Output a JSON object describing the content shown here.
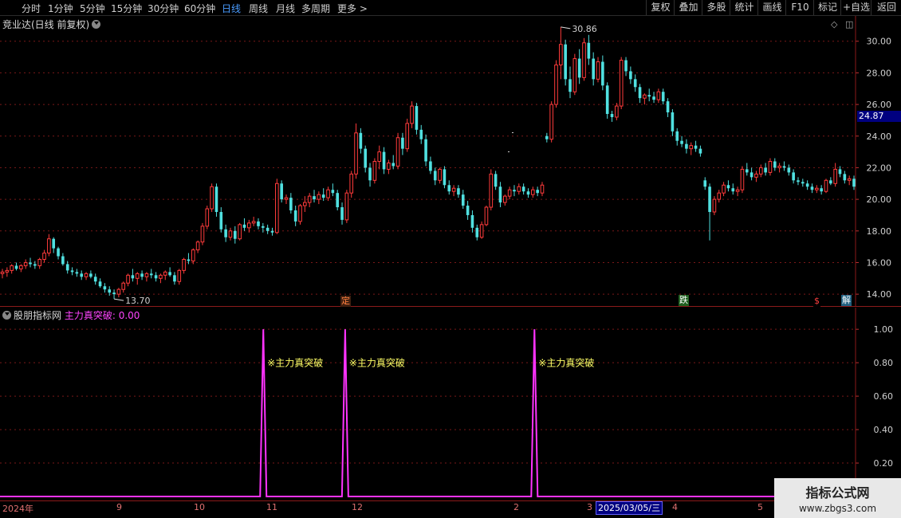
{
  "toolbar": {
    "tabs": [
      "分时",
      "1分钟",
      "5分钟",
      "15分钟",
      "30分钟",
      "60分钟",
      "日线",
      "周线",
      "月线",
      "多周期",
      "更多 >"
    ],
    "active_tab": "日线",
    "right_buttons": [
      "复权",
      "叠加",
      "多股",
      "统计",
      "画线",
      "F10",
      "标记",
      "+自选",
      "返回"
    ]
  },
  "main_chart": {
    "title": "竞业达(日线 前复权)",
    "high_marker": "30.86",
    "low_marker": "13.70",
    "current_price": "24.87",
    "event_tags": [
      {
        "label": "定",
        "color": "#ff8040",
        "bg": "#402010"
      },
      {
        "label": "跌",
        "color": "#ffffff",
        "bg": "#206020"
      },
      {
        "label": "$",
        "color": "#ff4040",
        "bg": "#000000"
      },
      {
        "label": "解",
        "color": "#ffffff",
        "bg": "#206080"
      }
    ],
    "colors": {
      "up": "#ff3b3b",
      "down": "#50e0e0",
      "grid": "#7a1818",
      "axis": "#8b1a1a"
    }
  },
  "indicator": {
    "source": "股朋指标网",
    "name": "主力真突破",
    "value": "0.00",
    "signal_label": "※主力真突破",
    "color": "#ff33ff",
    "label_color": "#ffff66"
  },
  "date_axis": {
    "labels": [
      "2024年",
      "9",
      "10",
      "11",
      "12",
      "2",
      "3",
      "4",
      "5"
    ],
    "cursor_date": "2025/03/05/三"
  },
  "watermark": {
    "title": "指标公式网",
    "url": "www.zbgs3.com"
  },
  "chart_data": [
    {
      "type": "candlestick",
      "title": "竞业达(日线 前复权)",
      "ylim": [
        13.2,
        31.6
      ],
      "y_ticks": [
        14,
        16,
        18,
        20,
        22,
        24,
        26,
        28,
        30
      ],
      "x_labels": [
        "2024年",
        "9",
        "10",
        "11",
        "12",
        "2",
        "3",
        "4",
        "5"
      ],
      "ohlc": [
        [
          15.3,
          15.6,
          15.0,
          15.4
        ],
        [
          15.4,
          15.7,
          15.1,
          15.5
        ],
        [
          15.5,
          15.9,
          15.3,
          15.8
        ],
        [
          15.8,
          16.0,
          15.5,
          15.6
        ],
        [
          15.6,
          15.9,
          15.4,
          15.8
        ],
        [
          15.8,
          16.2,
          15.6,
          16.0
        ],
        [
          16.0,
          16.3,
          15.7,
          15.9
        ],
        [
          15.9,
          16.1,
          15.6,
          15.8
        ],
        [
          15.8,
          16.3,
          15.6,
          16.2
        ],
        [
          16.2,
          16.8,
          16.0,
          16.6
        ],
        [
          16.6,
          17.8,
          16.4,
          17.5
        ],
        [
          17.5,
          17.6,
          16.6,
          16.9
        ],
        [
          16.9,
          17.0,
          16.2,
          16.4
        ],
        [
          16.4,
          16.6,
          15.8,
          15.9
        ],
        [
          15.9,
          16.1,
          15.3,
          15.5
        ],
        [
          15.5,
          15.7,
          15.2,
          15.4
        ],
        [
          15.4,
          15.6,
          15.1,
          15.3
        ],
        [
          15.3,
          15.5,
          14.9,
          15.1
        ],
        [
          15.1,
          15.4,
          14.9,
          15.3
        ],
        [
          15.3,
          15.5,
          15.0,
          15.1
        ],
        [
          15.1,
          15.3,
          14.6,
          14.8
        ],
        [
          14.8,
          15.0,
          14.4,
          14.5
        ],
        [
          14.5,
          14.7,
          14.1,
          14.3
        ],
        [
          14.3,
          14.5,
          13.9,
          14.1
        ],
        [
          14.1,
          14.3,
          13.7,
          14.0
        ],
        [
          14.0,
          14.4,
          13.8,
          14.3
        ],
        [
          14.3,
          14.8,
          14.1,
          14.7
        ],
        [
          14.7,
          15.3,
          14.5,
          15.2
        ],
        [
          15.2,
          15.6,
          14.8,
          15.0
        ],
        [
          15.0,
          15.4,
          14.6,
          15.3
        ],
        [
          15.3,
          15.5,
          14.9,
          15.1
        ],
        [
          15.1,
          15.4,
          14.8,
          15.3
        ],
        [
          15.3,
          15.6,
          15.0,
          15.2
        ],
        [
          15.2,
          15.4,
          14.8,
          15.0
        ],
        [
          15.0,
          15.3,
          14.7,
          15.2
        ],
        [
          15.2,
          15.5,
          14.9,
          15.4
        ],
        [
          15.4,
          15.7,
          15.1,
          15.2
        ],
        [
          15.2,
          15.4,
          14.6,
          14.8
        ],
        [
          14.8,
          15.6,
          14.6,
          15.5
        ],
        [
          15.5,
          16.3,
          15.3,
          16.2
        ],
        [
          16.2,
          16.6,
          15.9,
          16.1
        ],
        [
          16.1,
          16.9,
          15.9,
          16.8
        ],
        [
          16.8,
          17.4,
          16.6,
          17.3
        ],
        [
          17.3,
          18.5,
          17.1,
          18.3
        ],
        [
          18.3,
          19.6,
          18.1,
          19.4
        ],
        [
          19.4,
          21.0,
          19.2,
          20.8
        ],
        [
          20.8,
          21.0,
          18.9,
          19.2
        ],
        [
          19.2,
          19.5,
          17.9,
          18.1
        ],
        [
          18.1,
          18.4,
          17.3,
          17.6
        ],
        [
          17.6,
          18.2,
          17.4,
          18.0
        ],
        [
          18.0,
          18.3,
          17.2,
          17.5
        ],
        [
          17.5,
          18.5,
          17.4,
          18.4
        ],
        [
          18.4,
          18.8,
          18.0,
          18.2
        ],
        [
          18.2,
          18.7,
          17.9,
          18.5
        ],
        [
          18.5,
          18.9,
          18.3,
          18.6
        ],
        [
          18.6,
          18.8,
          18.1,
          18.3
        ],
        [
          18.3,
          18.5,
          17.9,
          18.2
        ],
        [
          18.2,
          18.4,
          17.8,
          18.0
        ],
        [
          18.0,
          18.2,
          17.7,
          17.9
        ],
        [
          17.9,
          21.3,
          17.8,
          21.0
        ],
        [
          21.0,
          21.2,
          19.8,
          20.0
        ],
        [
          20.0,
          20.3,
          19.7,
          20.1
        ],
        [
          20.1,
          20.4,
          19.1,
          19.3
        ],
        [
          19.3,
          19.6,
          18.3,
          18.6
        ],
        [
          18.6,
          19.7,
          18.4,
          19.6
        ],
        [
          19.6,
          20.2,
          19.2,
          19.8
        ],
        [
          19.8,
          20.4,
          19.5,
          20.2
        ],
        [
          20.2,
          20.6,
          19.8,
          20.0
        ],
        [
          20.0,
          20.5,
          19.7,
          20.3
        ],
        [
          20.3,
          20.7,
          19.9,
          20.1
        ],
        [
          20.1,
          20.8,
          19.9,
          20.6
        ],
        [
          20.6,
          21.0,
          20.2,
          20.4
        ],
        [
          20.4,
          20.6,
          19.3,
          19.5
        ],
        [
          19.5,
          19.8,
          18.4,
          18.7
        ],
        [
          18.7,
          20.6,
          18.5,
          20.4
        ],
        [
          20.4,
          21.8,
          20.1,
          21.6
        ],
        [
          21.6,
          24.8,
          21.3,
          24.2
        ],
        [
          24.2,
          24.5,
          22.9,
          23.2
        ],
        [
          23.2,
          23.4,
          21.7,
          22.0
        ],
        [
          22.0,
          22.3,
          20.8,
          21.2
        ],
        [
          21.2,
          22.6,
          21.0,
          22.4
        ],
        [
          22.4,
          23.4,
          21.9,
          23.0
        ],
        [
          23.0,
          23.3,
          21.6,
          21.9
        ],
        [
          21.9,
          22.5,
          21.6,
          22.3
        ],
        [
          22.3,
          22.8,
          21.9,
          22.1
        ],
        [
          22.1,
          24.2,
          21.9,
          23.9
        ],
        [
          23.9,
          24.2,
          22.8,
          23.2
        ],
        [
          23.2,
          25.1,
          23.0,
          24.8
        ],
        [
          24.8,
          26.2,
          24.5,
          25.9
        ],
        [
          25.9,
          26.1,
          24.1,
          24.4
        ],
        [
          24.4,
          24.7,
          23.5,
          23.8
        ],
        [
          23.8,
          24.1,
          22.1,
          22.4
        ],
        [
          22.4,
          22.7,
          21.6,
          21.8
        ],
        [
          21.8,
          22.0,
          20.9,
          21.2
        ],
        [
          21.2,
          22.0,
          21.0,
          21.9
        ],
        [
          21.9,
          22.1,
          20.7,
          20.9
        ],
        [
          20.9,
          21.2,
          20.3,
          20.5
        ],
        [
          20.5,
          20.9,
          20.2,
          20.7
        ],
        [
          20.7,
          20.9,
          20.1,
          20.3
        ],
        [
          20.3,
          20.6,
          19.4,
          19.6
        ],
        [
          19.6,
          19.9,
          18.7,
          19.0
        ],
        [
          19.0,
          19.3,
          17.9,
          18.2
        ],
        [
          18.2,
          18.4,
          17.4,
          17.6
        ],
        [
          17.6,
          18.6,
          17.5,
          18.4
        ],
        [
          18.4,
          19.6,
          18.3,
          19.5
        ],
        [
          19.5,
          21.9,
          19.3,
          21.6
        ],
        [
          21.6,
          21.8,
          20.6,
          20.8
        ],
        [
          20.8,
          21.1,
          19.5,
          19.8
        ],
        [
          19.8,
          20.3,
          19.6,
          20.2
        ],
        [
          20.2,
          20.8,
          20.0,
          20.6
        ],
        [
          20.6,
          20.9,
          20.2,
          20.5
        ],
        [
          20.5,
          21.0,
          20.3,
          20.8
        ],
        [
          20.8,
          21.0,
          20.3,
          20.5
        ],
        [
          20.5,
          20.7,
          20.1,
          20.3
        ],
        [
          20.3,
          20.8,
          20.1,
          20.6
        ],
        [
          20.6,
          20.8,
          20.2,
          20.4
        ],
        [
          20.4,
          21.1,
          20.2,
          20.9
        ],
        [
          24.0,
          24.2,
          23.6,
          23.8
        ],
        [
          23.8,
          26.2,
          23.6,
          26.0
        ],
        [
          26.0,
          28.8,
          25.8,
          28.5
        ],
        [
          28.5,
          30.9,
          27.6,
          29.8
        ],
        [
          29.8,
          30.1,
          27.2,
          27.6
        ],
        [
          27.6,
          28.4,
          26.4,
          26.8
        ],
        [
          26.8,
          29.2,
          26.6,
          28.9
        ],
        [
          28.9,
          29.5,
          27.3,
          27.7
        ],
        [
          27.7,
          30.2,
          27.5,
          29.9
        ],
        [
          29.9,
          30.4,
          28.5,
          28.9
        ],
        [
          28.9,
          29.3,
          27.2,
          27.6
        ],
        [
          27.6,
          29.0,
          27.4,
          28.7
        ],
        [
          28.7,
          29.1,
          26.9,
          27.2
        ],
        [
          27.2,
          27.4,
          25.1,
          25.4
        ],
        [
          25.4,
          25.6,
          24.9,
          25.2
        ],
        [
          25.2,
          26.1,
          25.0,
          25.9
        ],
        [
          25.9,
          29.0,
          25.7,
          28.8
        ],
        [
          28.8,
          29.0,
          27.8,
          28.1
        ],
        [
          28.1,
          28.4,
          27.3,
          27.6
        ],
        [
          27.6,
          27.9,
          26.8,
          27.1
        ],
        [
          27.1,
          27.3,
          26.1,
          26.4
        ],
        [
          26.4,
          26.7,
          26.0,
          26.6
        ],
        [
          26.6,
          27.0,
          26.2,
          26.5
        ],
        [
          26.5,
          26.8,
          26.1,
          26.3
        ],
        [
          26.3,
          27.0,
          26.1,
          26.8
        ],
        [
          26.8,
          27.0,
          26.0,
          26.2
        ],
        [
          26.2,
          26.4,
          25.2,
          25.5
        ],
        [
          25.5,
          25.7,
          24.0,
          24.3
        ],
        [
          24.3,
          24.5,
          23.4,
          23.7
        ],
        [
          23.7,
          24.0,
          23.3,
          23.5
        ],
        [
          23.5,
          23.8,
          22.9,
          23.2
        ],
        [
          23.2,
          23.6,
          22.8,
          23.4
        ],
        [
          23.4,
          23.7,
          23.0,
          23.2
        ],
        [
          23.2,
          23.4,
          22.7,
          22.9
        ],
        [
          21.2,
          21.4,
          20.6,
          20.8
        ],
        [
          20.8,
          21.0,
          17.4,
          19.2
        ],
        [
          19.2,
          20.2,
          19.0,
          20.0
        ],
        [
          20.0,
          20.6,
          19.8,
          20.4
        ],
        [
          20.4,
          21.1,
          20.2,
          20.9
        ],
        [
          20.9,
          21.2,
          20.5,
          20.7
        ],
        [
          20.7,
          21.0,
          20.3,
          20.5
        ],
        [
          20.5,
          20.8,
          20.2,
          20.6
        ],
        [
          20.6,
          22.1,
          20.4,
          21.9
        ],
        [
          21.9,
          22.3,
          21.5,
          21.7
        ],
        [
          21.7,
          22.0,
          21.2,
          21.4
        ],
        [
          21.4,
          21.8,
          21.1,
          21.6
        ],
        [
          21.6,
          22.2,
          21.4,
          22.0
        ],
        [
          22.0,
          22.3,
          21.5,
          21.7
        ],
        [
          21.7,
          22.6,
          21.5,
          22.4
        ],
        [
          22.4,
          22.6,
          21.8,
          22.0
        ],
        [
          22.0,
          22.3,
          21.7,
          22.1
        ],
        [
          22.1,
          22.4,
          21.8,
          22.0
        ],
        [
          22.0,
          22.2,
          21.5,
          21.7
        ],
        [
          21.7,
          21.9,
          21.0,
          21.2
        ],
        [
          21.2,
          21.4,
          20.9,
          21.1
        ],
        [
          21.1,
          21.3,
          20.8,
          21.0
        ],
        [
          21.0,
          21.2,
          20.6,
          20.8
        ],
        [
          20.8,
          21.0,
          20.4,
          20.6
        ],
        [
          20.6,
          20.9,
          20.4,
          20.7
        ],
        [
          20.7,
          20.9,
          20.3,
          20.5
        ],
        [
          20.5,
          21.3,
          20.4,
          21.2
        ],
        [
          21.2,
          21.4,
          20.9,
          21.0
        ],
        [
          21.0,
          22.3,
          20.8,
          21.9
        ],
        [
          21.9,
          22.1,
          21.4,
          21.6
        ],
        [
          21.6,
          21.8,
          21.0,
          21.2
        ],
        [
          21.2,
          21.5,
          20.9,
          21.3
        ],
        [
          21.3,
          21.5,
          20.6,
          20.8
        ]
      ]
    },
    {
      "type": "line",
      "series": [
        {
          "name": "主力真突破",
          "spikes_at_bar_fraction": [
            0.3064,
            0.4025,
            0.6248
          ],
          "spike_value": 1.0,
          "base_value": 0.0
        }
      ],
      "ylim": [
        0,
        1.12
      ],
      "y_ticks": [
        0.2,
        0.4,
        0.6,
        0.8,
        1.0
      ]
    }
  ]
}
